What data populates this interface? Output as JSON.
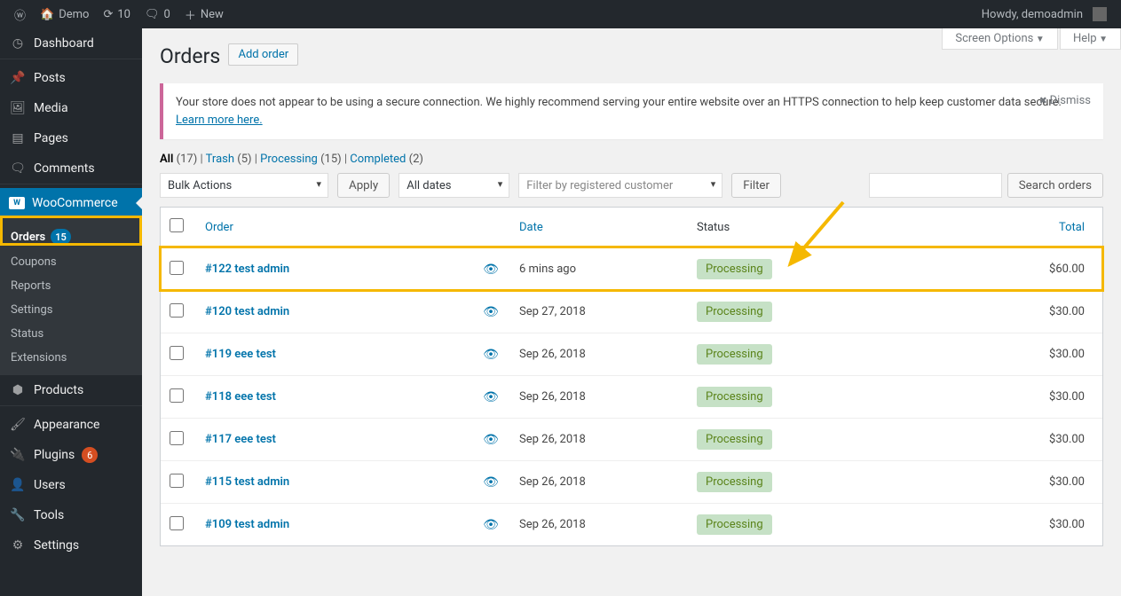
{
  "adminbar": {
    "site_name": "Demo",
    "updates_count": "10",
    "comments_count": "0",
    "new_label": "New",
    "howdy": "Howdy, demoadmin"
  },
  "menu": {
    "dashboard": "Dashboard",
    "posts": "Posts",
    "media": "Media",
    "pages": "Pages",
    "comments": "Comments",
    "woocommerce": "WooCommerce",
    "sub": {
      "orders": "Orders",
      "orders_badge": "15",
      "coupons": "Coupons",
      "reports": "Reports",
      "settings": "Settings",
      "status": "Status",
      "extensions": "Extensions"
    },
    "products": "Products",
    "appearance": "Appearance",
    "plugins": "Plugins",
    "plugins_badge": "6",
    "users": "Users",
    "tools": "Tools",
    "settings": "Settings"
  },
  "screen_meta": {
    "screen_options": "Screen Options",
    "help": "Help"
  },
  "page": {
    "heading": "Orders",
    "add_order": "Add order"
  },
  "notice": {
    "text_a": "Your store does not appear to be using a secure connection. We highly recommend serving your entire website over an HTTPS connection to help keep customer data secure. ",
    "link": "Learn more here.",
    "dismiss": "Dismiss"
  },
  "filters": {
    "views": [
      {
        "label": "All",
        "count": "(17)",
        "current": true
      },
      {
        "label": "Trash",
        "count": "(5)"
      },
      {
        "label": "Processing",
        "count": "(15)"
      },
      {
        "label": "Completed",
        "count": "(2)"
      }
    ],
    "bulk_actions": "Bulk Actions",
    "apply": "Apply",
    "all_dates": "All dates",
    "customer_placeholder": "Filter by registered customer",
    "filter": "Filter",
    "search": "Search orders"
  },
  "table": {
    "headers": {
      "order": "Order",
      "date": "Date",
      "status": "Status",
      "total": "Total"
    },
    "rows": [
      {
        "order": "#122 test admin",
        "date": "6 mins ago",
        "status": "Processing",
        "total": "$60.00",
        "highlight": true
      },
      {
        "order": "#120 test admin",
        "date": "Sep 27, 2018",
        "status": "Processing",
        "total": "$30.00"
      },
      {
        "order": "#119 eee test",
        "date": "Sep 26, 2018",
        "status": "Processing",
        "total": "$30.00"
      },
      {
        "order": "#118 eee test",
        "date": "Sep 26, 2018",
        "status": "Processing",
        "total": "$30.00"
      },
      {
        "order": "#117 eee test",
        "date": "Sep 26, 2018",
        "status": "Processing",
        "total": "$30.00"
      },
      {
        "order": "#115 test admin",
        "date": "Sep 26, 2018",
        "status": "Processing",
        "total": "$30.00"
      },
      {
        "order": "#109 test admin",
        "date": "Sep 26, 2018",
        "status": "Processing",
        "total": "$30.00"
      }
    ]
  }
}
